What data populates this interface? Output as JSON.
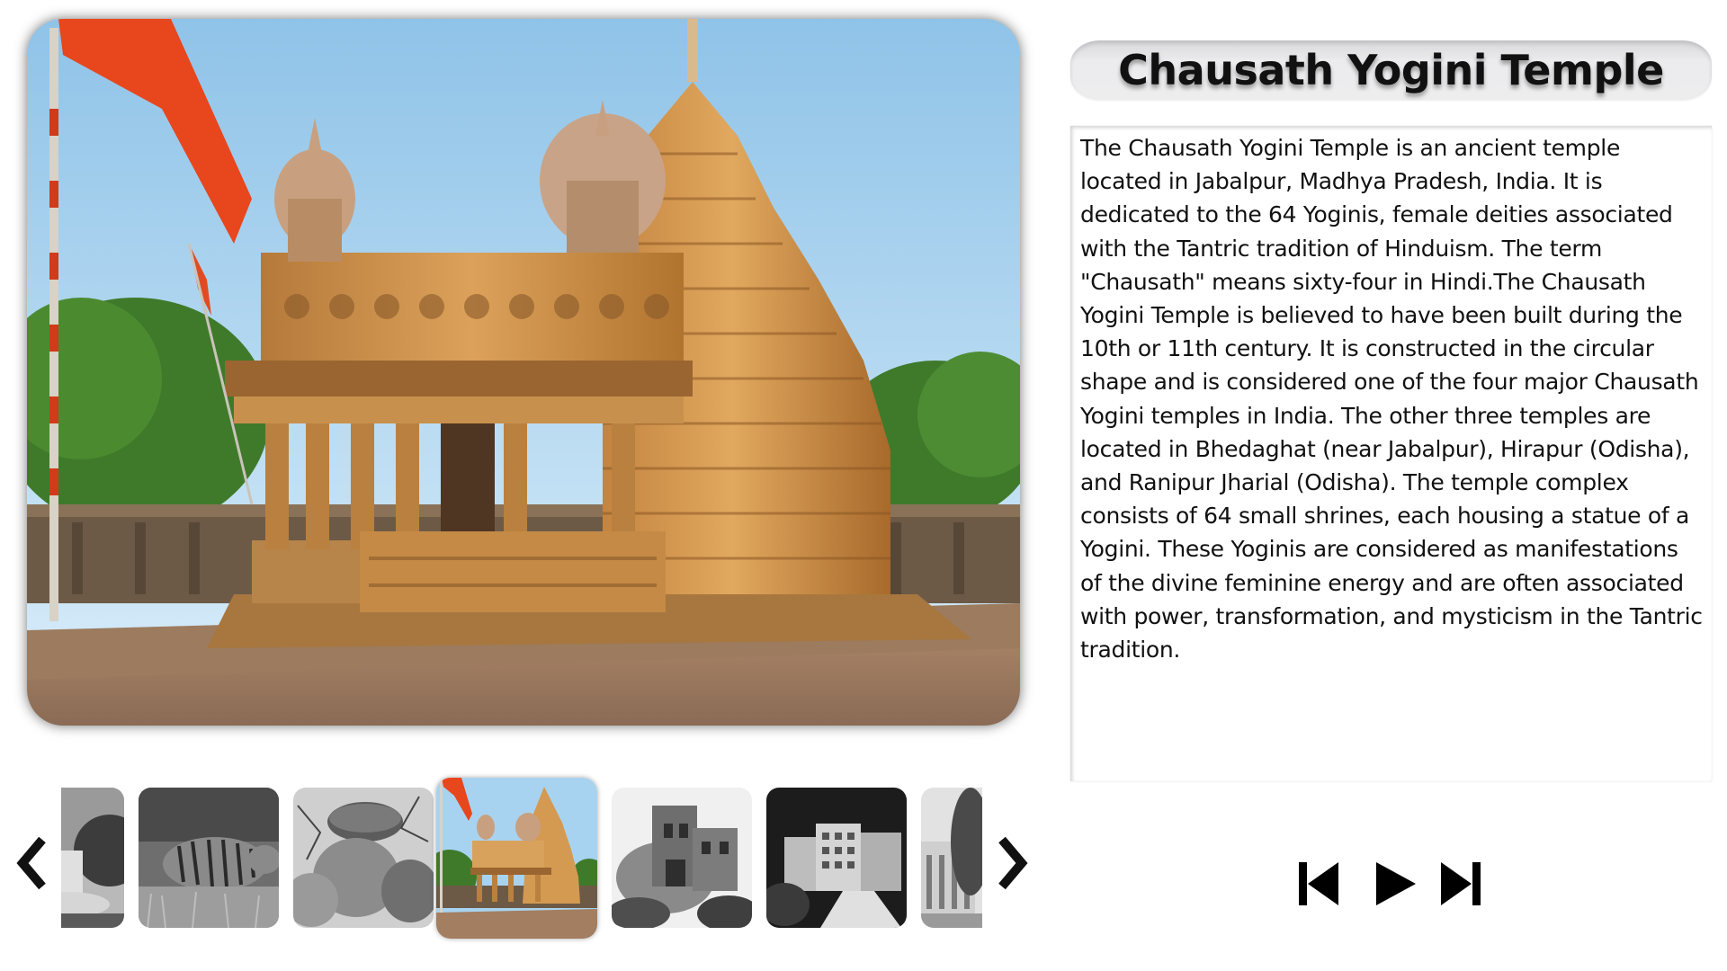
{
  "slide": {
    "title": "Chausath Yogini Temple",
    "description": "The Chausath Yogini Temple is an ancient temple located in Jabalpur, Madhya Pradesh, India. It is dedicated to the 64 Yoginis, female deities associated with the Tantric tradition of Hinduism. The term \"Chausath\" means sixty-four in Hindi.The Chausath Yogini Temple is believed to have been built during the 10th or 11th century. It is constructed in the circular shape and is considered one of the four major Chausath Yogini temples in India. The other three temples are located in Bhedaghat (near Jabalpur), Hirapur (Odisha), and Ranipur Jharial (Odisha). The temple complex consists of 64 small shrines, each housing a statue of a Yogini. These Yoginis are considered as manifestations of the divine feminine energy and are often associated with power, transformation, and mysticism in the Tantric tradition.",
    "main_image_icon": "temple-photo"
  },
  "thumbnails": [
    {
      "icon": "statue-photo",
      "active": false,
      "grayscale": true
    },
    {
      "icon": "tiger-photo",
      "active": false,
      "grayscale": true
    },
    {
      "icon": "balancing-rock-photo",
      "active": false,
      "grayscale": true
    },
    {
      "icon": "temple-photo",
      "active": true,
      "grayscale": false
    },
    {
      "icon": "fort-ruins-photo",
      "active": false,
      "grayscale": true
    },
    {
      "icon": "campus-building-photo",
      "active": false,
      "grayscale": true
    },
    {
      "icon": "colonial-building-photo",
      "active": false,
      "grayscale": true
    }
  ],
  "navigation": {
    "prev_icon": "chevron-left-icon",
    "next_icon": "chevron-right-icon"
  },
  "controls": {
    "previous_icon": "skip-previous-icon",
    "play_icon": "play-icon",
    "next_icon": "skip-next-icon"
  },
  "colors": {
    "title_pill": "#ececee",
    "text": "#111111",
    "background": "#ffffff",
    "flag": "#e8461c",
    "stone": "#c98a42",
    "sky": "#9dc9e8"
  }
}
